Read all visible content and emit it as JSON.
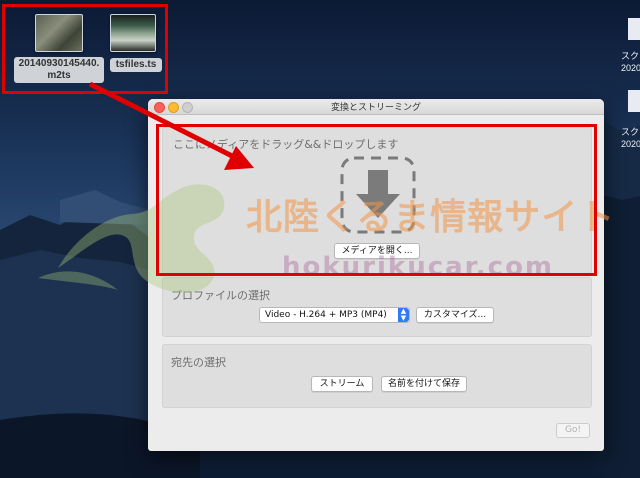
{
  "desktop": {
    "icons": [
      {
        "name": "20140930145440.",
        "name_line2": "m2ts"
      },
      {
        "name": "tsfiles.ts"
      }
    ],
    "right_labels": [
      {
        "line1": "スク",
        "line2": "2020"
      },
      {
        "line1": "スク",
        "line2": "2020"
      }
    ]
  },
  "window": {
    "title": "変換とストリーミング",
    "drop": {
      "label": "ここにメディアをドラッグ&&ドロップします",
      "open_button": "メディアを開く..."
    },
    "profile": {
      "label": "プロファイルの選択",
      "selected": "Video - H.264 + MP3 (MP4)",
      "customize_button": "カスタマイズ..."
    },
    "destination": {
      "label": "宛先の選択",
      "stream_button": "ストリーム",
      "save_button": "名前を付けて保存"
    },
    "go_button": "Go!"
  },
  "watermark": {
    "title": "北陸くるま情報サイト",
    "url": "hokurikucar.com"
  },
  "colors": {
    "annotation_red": "#e00000",
    "select_blue": "#2f7bf5"
  }
}
